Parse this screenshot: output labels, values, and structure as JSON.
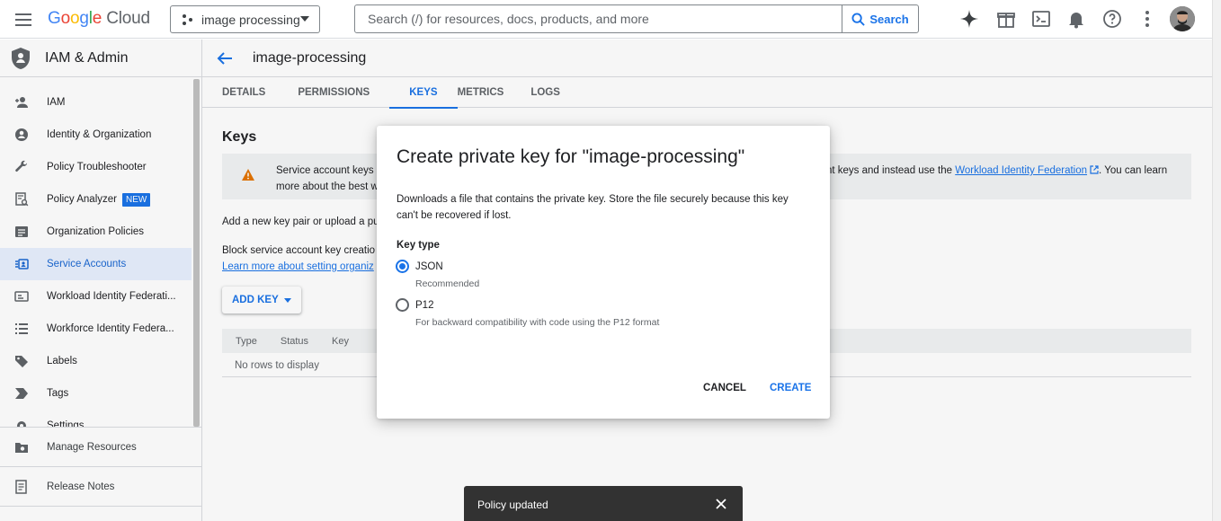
{
  "topbar": {
    "logo_google": "Google",
    "logo_cloud": "Cloud",
    "project": "image processing",
    "search_placeholder": "Search (/) for resources, docs, products, and more",
    "search_button": "Search"
  },
  "sidebar": {
    "title": "IAM & Admin",
    "items": [
      {
        "label": "IAM",
        "icon": "person-add-icon"
      },
      {
        "label": "Identity & Organization",
        "icon": "account-circle-icon"
      },
      {
        "label": "Policy Troubleshooter",
        "icon": "wrench-icon"
      },
      {
        "label": "Policy Analyzer",
        "icon": "policy-analyzer-icon",
        "badge": "NEW"
      },
      {
        "label": "Organization Policies",
        "icon": "list-box-icon"
      },
      {
        "label": "Service Accounts",
        "icon": "service-account-icon",
        "active": true
      },
      {
        "label": "Workload Identity Federati...",
        "icon": "id-card-icon"
      },
      {
        "label": "Workforce Identity Federa...",
        "icon": "list-icon"
      },
      {
        "label": "Labels",
        "icon": "label-icon"
      },
      {
        "label": "Tags",
        "icon": "tag-arrow-icon"
      },
      {
        "label": "Settings",
        "icon": "gear-icon"
      }
    ],
    "bottom": [
      {
        "label": "Manage Resources",
        "icon": "folder-gear-icon"
      },
      {
        "label": "Release Notes",
        "icon": "notes-icon"
      }
    ]
  },
  "page": {
    "title": "image-processing",
    "tabs": [
      "DETAILS",
      "PERMISSIONS",
      "KEYS",
      "METRICS",
      "LOGS"
    ],
    "active_tab": "KEYS",
    "section_title": "Keys",
    "warning_left_1": "Service account keys",
    "warning_left_2": "more about the best w",
    "warning_right_1": "nt keys and instead use the ",
    "warning_link": "Workload Identity Federation",
    "warning_right_2": ". You can learn",
    "line_add": "Add a new key pair or upload a pu",
    "line_block": "Block service account key creatio",
    "line_learn_link": "Learn more about setting organiz",
    "add_key_button": "ADD KEY",
    "table_headers": [
      "Type",
      "Status",
      "Key"
    ],
    "table_empty": "No rows to display"
  },
  "dialog": {
    "title": "Create private key for \"image-processing\"",
    "description": "Downloads a file that contains the private key. Store the file securely because this key can't be recovered if lost.",
    "key_type_label": "Key type",
    "options": [
      {
        "label": "JSON",
        "sub": "Recommended",
        "checked": true
      },
      {
        "label": "P12",
        "sub": "For backward compatibility with code using the P12 format",
        "checked": false
      }
    ],
    "cancel": "CANCEL",
    "create": "CREATE"
  },
  "snackbar": {
    "message": "Policy updated"
  },
  "colors": {
    "accent": "#1a73e8",
    "active_bg": "#e8f0fe",
    "warning": "#e37400"
  }
}
